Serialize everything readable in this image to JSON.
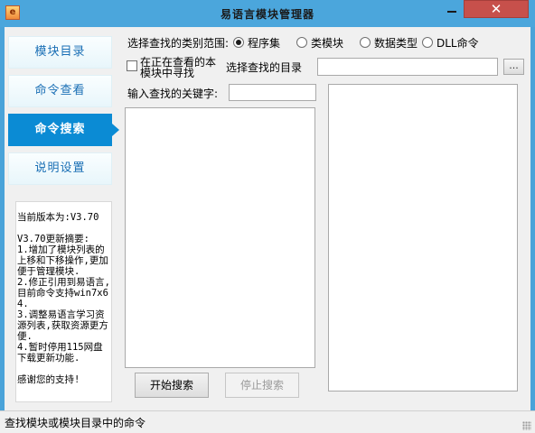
{
  "window": {
    "title": "易语言模块管理器",
    "app_icon": "e-language-app-icon",
    "close_label": "✕"
  },
  "nav": {
    "items": [
      {
        "label": "模块目录",
        "active": false
      },
      {
        "label": "命令查看",
        "active": false
      },
      {
        "label": "命令搜索",
        "active": true
      },
      {
        "label": "说明设置",
        "active": false
      }
    ]
  },
  "info": {
    "text": "当前版本为:V3.70\n\nV3.70更新摘要:\n1.增加了模块列表的上移和下移操作,更加便于管理模块.\n2.修正引用到易语言,目前命令支持win7x64.\n3.调整易语言学习资源列表,获取资源更方便.\n4.暂时停用115网盘下载更新功能.\n\n感谢您的支持!"
  },
  "search": {
    "category_label": "选择查找的类别范围:",
    "categories": [
      {
        "label": "程序集",
        "selected": true
      },
      {
        "label": "类模块",
        "selected": false
      },
      {
        "label": "数据类型",
        "selected": false
      },
      {
        "label": "DLL命令",
        "selected": false
      }
    ],
    "in_current_label_line1": "在正在查看的本",
    "in_current_label_line2": "模块中寻找",
    "in_current_checked": false,
    "dir_label": "选择查找的目录",
    "dir_value": "",
    "browse_label": "...",
    "keyword_label": "输入查找的关键字:",
    "keyword_value": "",
    "start_label": "开始搜索",
    "stop_label": "停止搜索"
  },
  "status": {
    "text": "查找模块或模块目录中的命令"
  }
}
